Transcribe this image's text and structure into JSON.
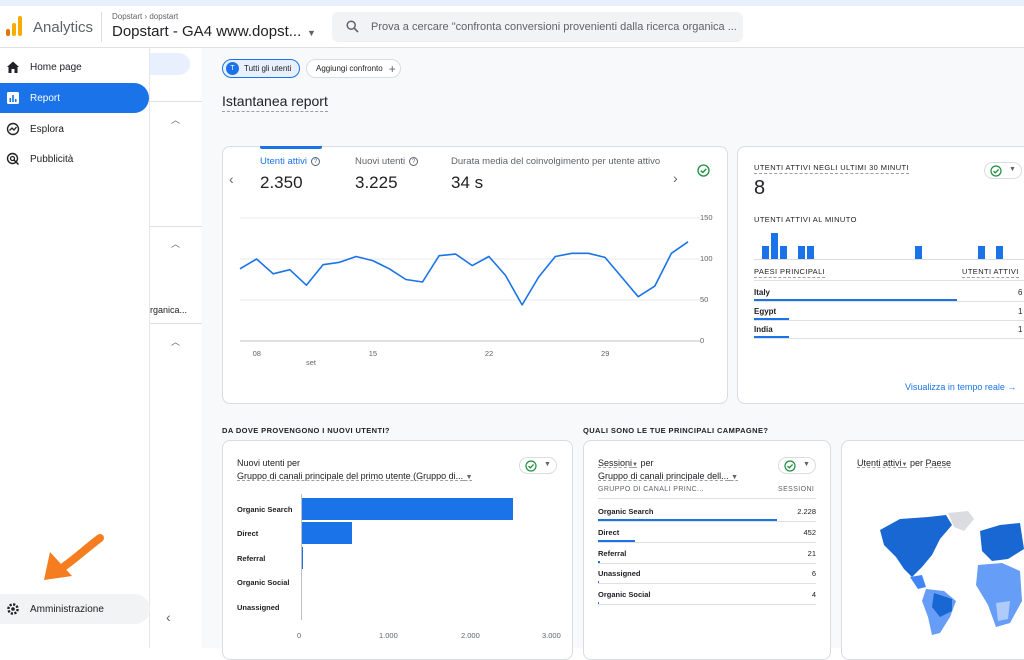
{
  "header": {
    "app_title": "Analytics",
    "breadcrumb": "Dopstart › dopstart",
    "property": "Dopstart - GA4 www.dopst...",
    "search_placeholder": "Prova a cercare \"confronta conversioni provenienti dalla ricerca organica ..."
  },
  "sidebar": {
    "items": [
      {
        "label": "Home page",
        "icon": "home-icon"
      },
      {
        "label": "Report",
        "icon": "bar-chart-icon"
      },
      {
        "label": "Esplora",
        "icon": "explore-icon"
      },
      {
        "label": "Pubblicità",
        "icon": "advertising-icon"
      }
    ],
    "admin_label": "Amministrazione",
    "sub_text": "rganica..."
  },
  "filters": {
    "segment_avatar": "T",
    "segment_label": "Tutti gli utenti",
    "compare_label": "Aggiungi confronto"
  },
  "page_title": "Istantanea report",
  "overview": {
    "tabs": [
      {
        "label": "Utenti attivi",
        "value": "2.350"
      },
      {
        "label": "Nuovi utenti",
        "value": "3.225"
      },
      {
        "label": "Durata media del coinvolgimento per utente attivo",
        "value": "34 s"
      }
    ],
    "y_ticks": [
      "150",
      "100",
      "50",
      "0"
    ],
    "x_ticks": [
      "08",
      "15",
      "22",
      "29"
    ],
    "x_sub": "set"
  },
  "chart_data": {
    "type": "line",
    "x": [
      7,
      8,
      9,
      10,
      11,
      12,
      13,
      14,
      15,
      16,
      17,
      18,
      19,
      20,
      21,
      22,
      23,
      24,
      25,
      26,
      27,
      28,
      29,
      30,
      31,
      32,
      33,
      34
    ],
    "series": [
      {
        "values": [
          88,
          100,
          82,
          87,
          68,
          93,
          96,
          103,
          98,
          88,
          75,
          72,
          104,
          106,
          92,
          103,
          80,
          44,
          78,
          103,
          107,
          107,
          102,
          78,
          54,
          67,
          107,
          121
        ]
      }
    ],
    "xlabel": "",
    "ylabel": "",
    "ylim": [
      0,
      150
    ],
    "grid": true
  },
  "realtime": {
    "title": "UTENTI ATTIVI NEGLI ULTIMI 30 MINUTI",
    "value": "8",
    "per_minute_title": "UTENTI ATTIVI AL MINUTO",
    "per_minute": [
      1,
      2,
      1,
      0,
      1,
      1,
      0,
      0,
      0,
      0,
      0,
      0,
      0,
      0,
      0,
      0,
      0,
      1,
      0,
      0,
      0,
      0,
      0,
      0,
      1,
      0,
      1,
      0,
      0,
      0
    ],
    "countries_header": "PAESI PRINCIPALI",
    "users_header": "UTENTI ATTIVI",
    "countries": [
      {
        "name": "Italy",
        "value": "6",
        "fraction": 0.75
      },
      {
        "name": "Egypt",
        "value": "1",
        "fraction": 0.13
      },
      {
        "name": "India",
        "value": "1",
        "fraction": 0.13
      }
    ],
    "link": "Visualizza in tempo reale"
  },
  "new_users": {
    "section_title": "DA DOVE PROVENGONO I NUOVI UTENTI?",
    "card_title_prefix": "Nuovi utenti per",
    "card_title_dim": "Gruppo di canali principale del primo utente (Gruppo di...",
    "bars": [
      {
        "label": "Organic Search",
        "value": 2600
      },
      {
        "label": "Direct",
        "value": 620
      },
      {
        "label": "Referral",
        "value": 25
      },
      {
        "label": "Organic Social",
        "value": 8
      },
      {
        "label": "Unassigned",
        "value": 6
      }
    ],
    "x_ticks": [
      "0",
      "1.000",
      "2.000",
      "3.000"
    ]
  },
  "campaigns": {
    "section_title": "QUALI SONO LE TUE PRINCIPALI CAMPAGNE?",
    "card_title_prefix": "Sessioni",
    "card_title_per": "per",
    "card_title_dim": "Gruppo di canali principale dell...",
    "col_dim": "GRUPPO DI CANALI PRINC...",
    "col_metric": "SESSIONI",
    "rows": [
      {
        "label": "Organic Search",
        "value": "2.228",
        "fraction": 0.82
      },
      {
        "label": "Direct",
        "value": "452",
        "fraction": 0.17
      },
      {
        "label": "Referral",
        "value": "21",
        "fraction": 0.01
      },
      {
        "label": "Unassigned",
        "value": "6",
        "fraction": 0.005
      },
      {
        "label": "Organic Social",
        "value": "4",
        "fraction": 0.004
      }
    ]
  },
  "geo": {
    "title_metric": "Utenti attivi",
    "title_per": "per",
    "title_dim": "Paese"
  },
  "colors": {
    "accent": "#1a73e8",
    "success": "#1e8e3e",
    "annotation_arrow": "#f57c1f"
  }
}
